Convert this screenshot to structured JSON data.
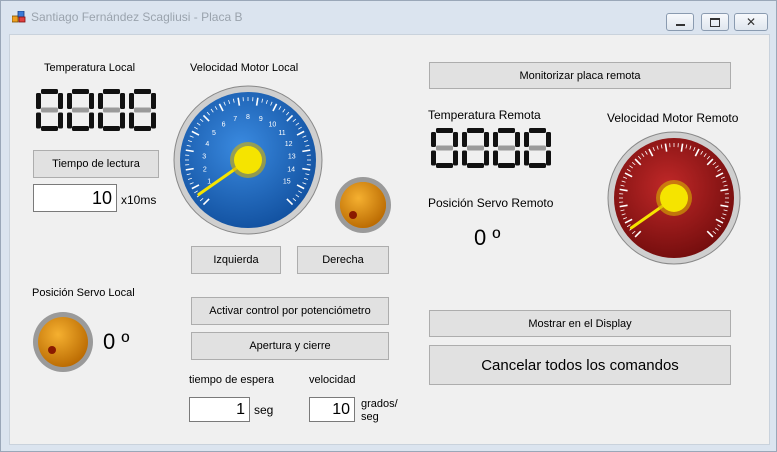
{
  "window": {
    "title": "Santiago Fernández Scagliusi - Placa B",
    "controls": [
      "minimize",
      "maximize",
      "close"
    ]
  },
  "local": {
    "temp_label": "Temperatura Local",
    "temp_display": "8888",
    "read_time_button": "Tiempo de lectura",
    "read_time_value": "10",
    "read_time_unit": "x10ms",
    "motor_label": "Velocidad Motor Local",
    "motor_ticks": [
      "1",
      "2",
      "3",
      "4",
      "5",
      "6",
      "7",
      "8",
      "9",
      "10",
      "11",
      "12",
      "13",
      "14",
      "15"
    ],
    "servo_label": "Posición Servo Local",
    "servo_value": "0 º",
    "left_button": "Izquierda",
    "right_button": "Derecha"
  },
  "controls": {
    "pot_button": "Activar control por potenciómetro",
    "open_close_button": "Apertura y cierre",
    "wait_label": "tiempo de espera",
    "wait_value": "1",
    "wait_unit": "seg",
    "speed_label": "velocidad",
    "speed_value": "10",
    "speed_unit_1": "grados/",
    "speed_unit_2": "seg"
  },
  "remote": {
    "monitor_button": "Monitorizar placa remota",
    "temp_label": "Temperatura Remota",
    "temp_display": "8888",
    "motor_label": "Velocidad Motor Remoto",
    "servo_label": "Posición Servo Remoto",
    "servo_value": "0 º",
    "show_display_button": "Mostrar en el Display",
    "cancel_button": "Cancelar todos los comandos"
  },
  "colors": {
    "blue_gauge": "#1e6fc8",
    "red_gauge": "#a01818",
    "knob": "#e08a00",
    "needle": "#f5e400"
  }
}
